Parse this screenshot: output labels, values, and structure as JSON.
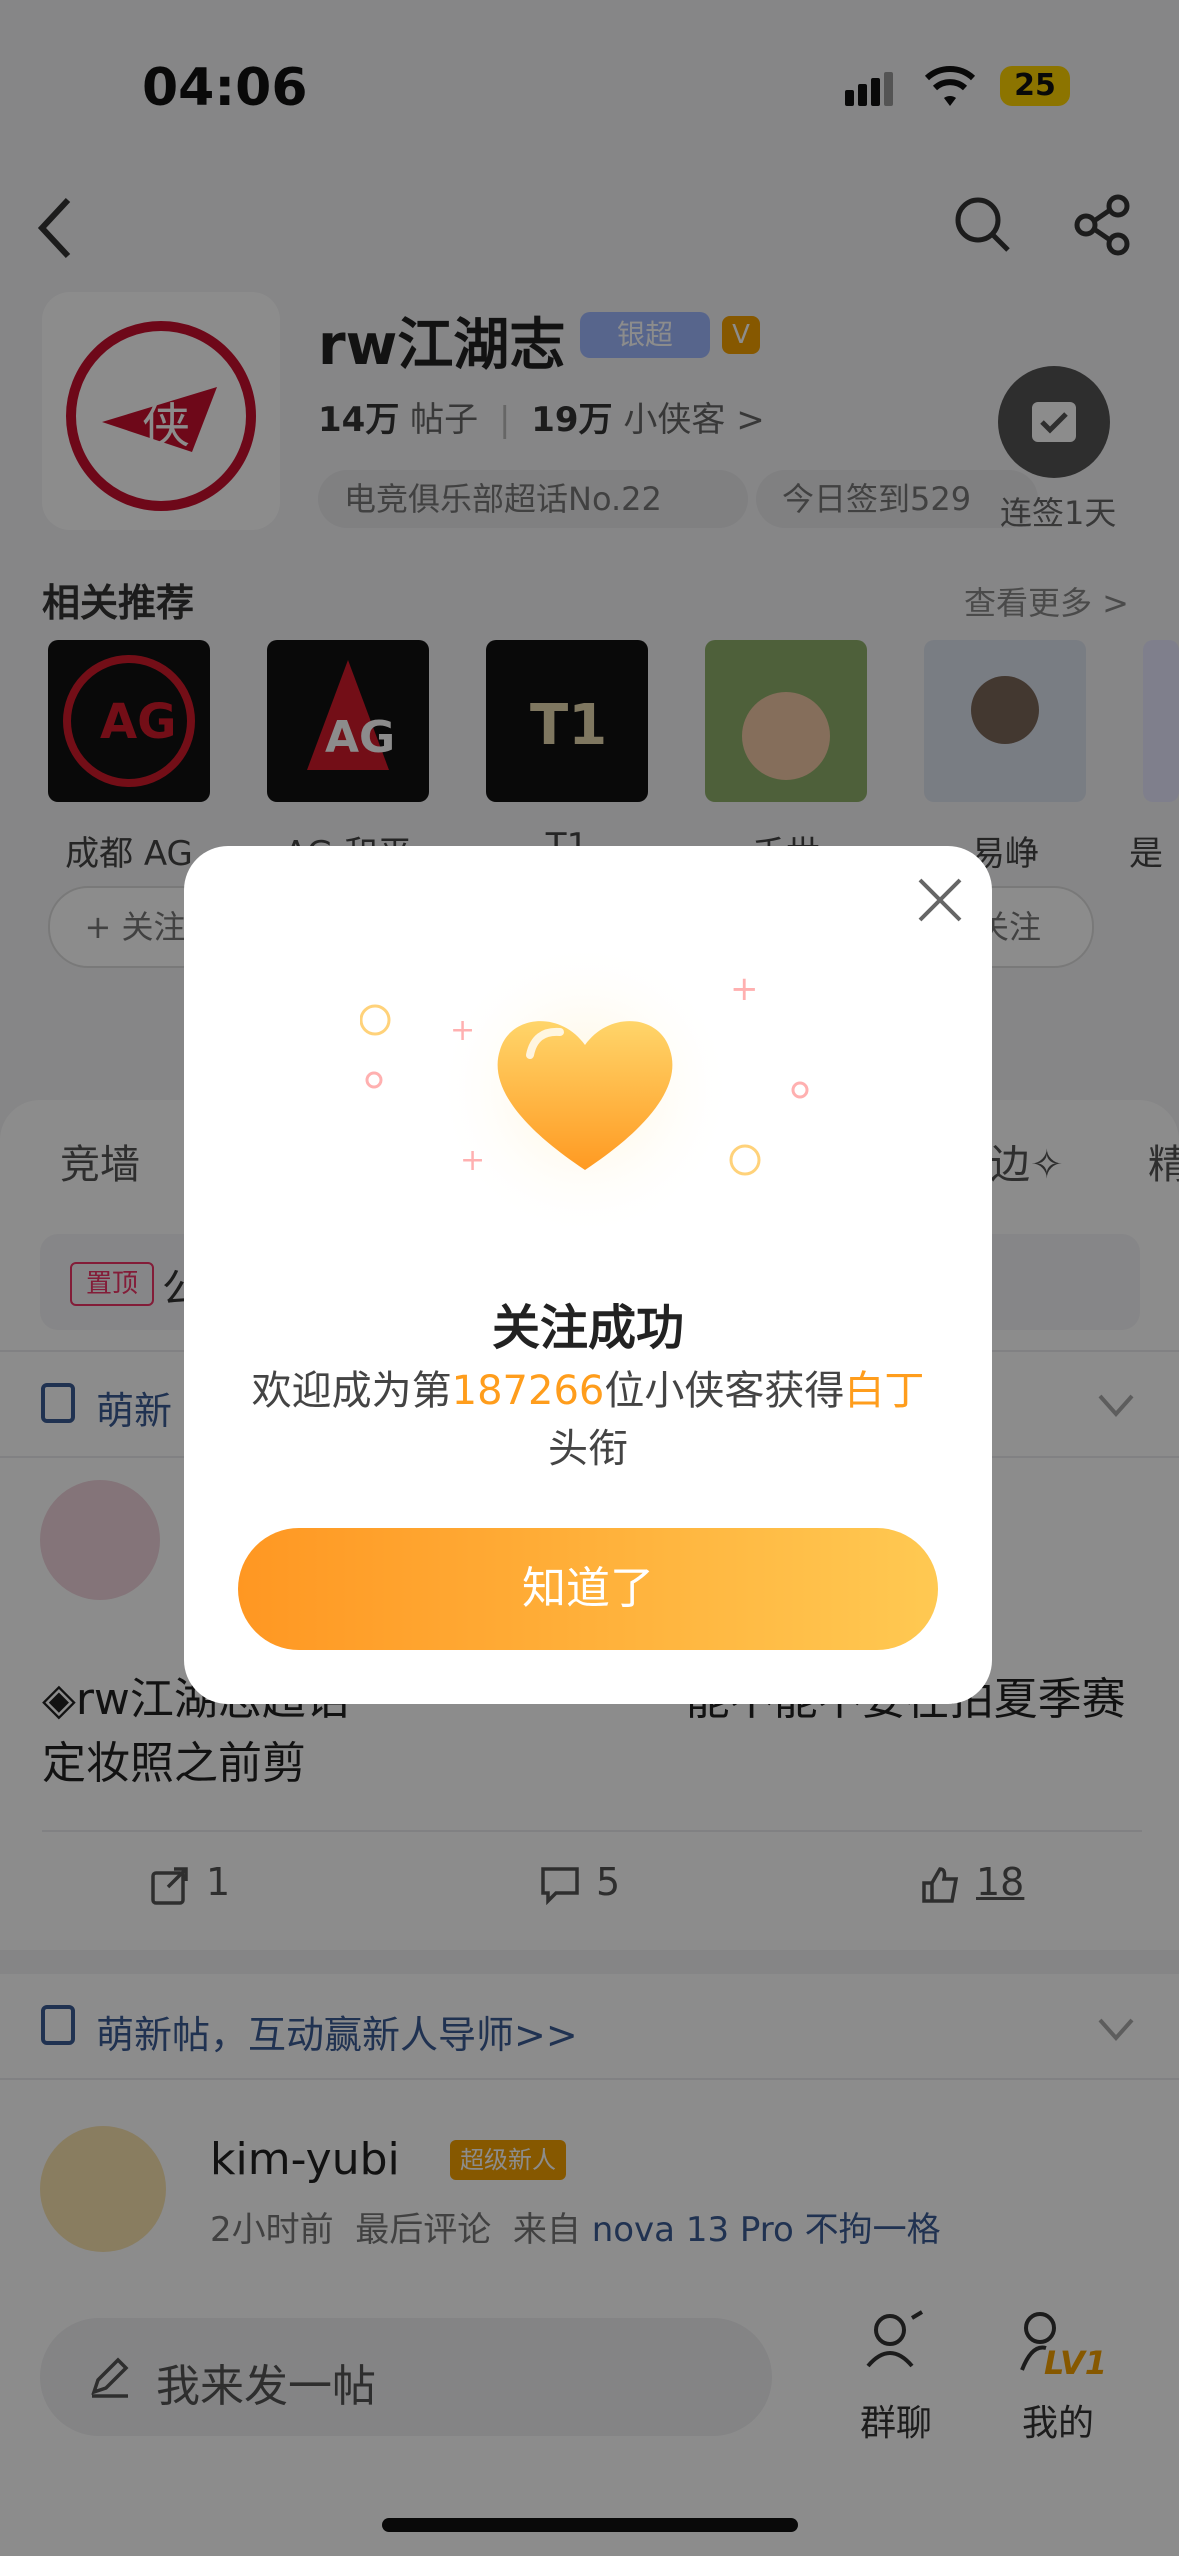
{
  "status_bar": {
    "time": "04:06",
    "battery": "25"
  },
  "header": {
    "title": "rw江湖志",
    "badge_silver": "银超",
    "badge_v": "V",
    "posts_count": "14万",
    "posts_label": "帖子",
    "fans_count": "19万",
    "fans_label": "小侠客",
    "fans_chevron": ">",
    "rank_pill": "电竞俱乐部超话No.22",
    "checkin_pill": "今日签到529",
    "checkin_label": "连签1天"
  },
  "related": {
    "title": "相关推荐",
    "see_more": "查看更多 >",
    "items": [
      {
        "name": "成都 AG",
        "follow": "+ 关注"
      },
      {
        "name": "AG 和平"
      },
      {
        "name": "T1"
      },
      {
        "name": "千世"
      },
      {
        "name": "易峥",
        "follow": "关注"
      },
      {
        "name": "是"
      }
    ]
  },
  "tabs": [
    "竞墙",
    "边✧",
    "精"
  ],
  "pinned": {
    "tag": "置顶",
    "text": "公"
  },
  "newbie_row": "萌新帖，互动赢新人导师>>",
  "newbie_row_short": "萌新",
  "post": {
    "text": "◈rw江湖志超话  ·  ·  ·  ·  ·  ·  ·  ·  ·  ·  ·  ·能不能不要在拍夏季赛定妆照之前剪",
    "share_count": "1",
    "comment_count": "5",
    "like_count": "18"
  },
  "user_post": {
    "name": "kim-yubi",
    "badge": "超级新人",
    "time": "2小时前",
    "last_comment": "最后评论",
    "from": "来自",
    "device": "nova 13 Pro 不拘一格"
  },
  "bottom": {
    "compose_placeholder": "我来发一帖",
    "group_chat": "群聊",
    "mine": "我的",
    "level": "LV1"
  },
  "modal": {
    "title": "关注成功",
    "desc_prefix": "欢迎成为第",
    "desc_number": "187266",
    "desc_middle": "位小侠客获得",
    "desc_rank": "白丁",
    "desc_suffix": "头衔",
    "cta": "知道了"
  },
  "colors": {
    "accent": "#ff9d1c",
    "link": "#3b5b94",
    "badge_blue": "#9fb8ff",
    "gold": "#f4a000"
  }
}
